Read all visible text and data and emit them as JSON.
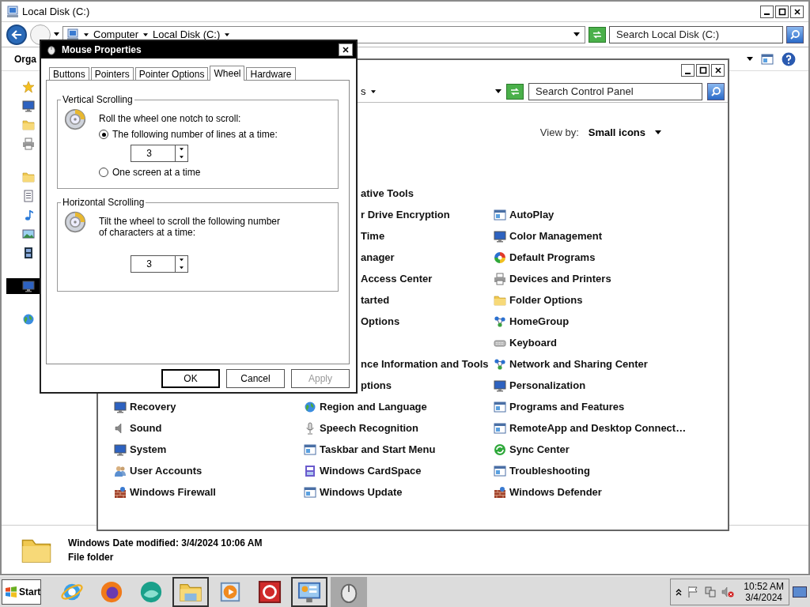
{
  "explorer": {
    "title": "Local Disk (C:)",
    "breadcrumb": [
      "Computer",
      "Local Disk (C:)"
    ],
    "search": {
      "placeholder": "Search Local Disk (C:)"
    },
    "organize": "Orga",
    "nav": [
      {
        "kind": "star",
        "selected": false
      },
      {
        "kind": "monitor",
        "selected": false
      },
      {
        "kind": "folder",
        "selected": false
      },
      {
        "kind": "printer",
        "selected": false
      },
      {
        "kind": "folder",
        "selected": false
      },
      {
        "kind": "document",
        "selected": false
      },
      {
        "kind": "music",
        "selected": false
      },
      {
        "kind": "picture",
        "selected": false
      },
      {
        "kind": "film",
        "selected": false
      },
      {
        "kind": "monitor",
        "selected": true
      },
      {
        "kind": "globe",
        "selected": false
      }
    ],
    "details": {
      "name": "Windows",
      "modified": "Date modified: 3/4/2024 10:06 AM",
      "type": "File folder"
    }
  },
  "control_panel": {
    "breadcrumb_tail": "s",
    "search": {
      "placeholder": "Search Control Panel"
    },
    "view_by": {
      "label": "View by:",
      "value": "Small icons"
    },
    "columns": [
      {
        "groups": [
          [
            {
              "label": "Recovery",
              "kind": "monitor"
            },
            {
              "label": "Sound",
              "kind": "speaker"
            },
            {
              "label": "System",
              "kind": "monitor"
            },
            {
              "label": "User Accounts",
              "kind": "people"
            },
            {
              "label": "Windows Firewall",
              "kind": "wall"
            }
          ]
        ]
      },
      {
        "groups": [
          [
            {
              "label": "ative Tools",
              "kind": "partial"
            },
            {
              "label": "r Drive Encryption",
              "kind": "partial"
            },
            {
              "label": "Time",
              "kind": "partial"
            },
            {
              "label": "anager",
              "kind": "partial"
            },
            {
              "label": "Access Center",
              "kind": "partial"
            },
            {
              "label": "tarted",
              "kind": "partial"
            },
            {
              "label": "Options",
              "kind": "partial"
            }
          ],
          [
            {
              "label": "nce Information and Tools",
              "kind": "partial"
            },
            {
              "label": "ptions",
              "kind": "partial"
            },
            {
              "label": "Region and Language",
              "kind": "globe"
            },
            {
              "label": "Speech Recognition",
              "kind": "mic"
            },
            {
              "label": "Taskbar and Start Menu",
              "kind": "window"
            },
            {
              "label": "Windows CardSpace",
              "kind": "card"
            },
            {
              "label": "Windows Update",
              "kind": "window"
            }
          ]
        ]
      },
      {
        "groups": [
          [
            {
              "label": "AutoPlay",
              "kind": "window"
            },
            {
              "label": "Color Management",
              "kind": "monitor"
            },
            {
              "label": "Default Programs",
              "kind": "colorwheel"
            },
            {
              "label": "Devices and Printers",
              "kind": "printer"
            },
            {
              "label": "Folder Options",
              "kind": "folder"
            },
            {
              "label": "HomeGroup",
              "kind": "network"
            },
            {
              "label": "Keyboard",
              "kind": "keyboard"
            },
            {
              "label": "Network and Sharing Center",
              "kind": "network"
            },
            {
              "label": "Personalization",
              "kind": "monitor"
            },
            {
              "label": "Programs and Features",
              "kind": "window"
            },
            {
              "label": "RemoteApp and Desktop Connect…",
              "kind": "window"
            },
            {
              "label": "Sync Center",
              "kind": "sync"
            },
            {
              "label": "Troubleshooting",
              "kind": "window"
            },
            {
              "label": "Windows Defender",
              "kind": "wall"
            }
          ]
        ]
      }
    ]
  },
  "dialog": {
    "title": "Mouse Properties",
    "tabs": [
      {
        "label": "Buttons",
        "selected": false
      },
      {
        "label": "Pointers",
        "selected": false
      },
      {
        "label": "Pointer Options",
        "selected": false
      },
      {
        "label": "Wheel",
        "selected": true
      },
      {
        "label": "Hardware",
        "selected": false
      }
    ],
    "vertical": {
      "legend": "Vertical Scrolling",
      "prompt": "Roll the wheel one notch to scroll:",
      "options": [
        {
          "label": "The following number of lines at a time:",
          "selected": true,
          "value": "3"
        },
        {
          "label": "One screen at a time",
          "selected": false
        }
      ]
    },
    "horizontal": {
      "legend": "Horizontal Scrolling",
      "prompt": "Tilt the wheel to scroll the following number of characters at a time:",
      "value": "3"
    },
    "buttons": [
      {
        "label": "OK",
        "default": true,
        "disabled": false
      },
      {
        "label": "Cancel",
        "default": false,
        "disabled": false
      },
      {
        "label": "Apply",
        "default": false,
        "disabled": true
      }
    ]
  },
  "taskbar": {
    "start": "Start",
    "apps": [
      {
        "kind": "ie",
        "open": false,
        "selected": false
      },
      {
        "kind": "fox",
        "open": false,
        "selected": false
      },
      {
        "kind": "bubble",
        "open": false,
        "selected": false
      },
      {
        "kind": "explorer",
        "open": true,
        "selected": false
      },
      {
        "kind": "media",
        "open": false,
        "selected": false
      },
      {
        "kind": "redapp",
        "open": false,
        "selected": false
      },
      {
        "kind": "cpanel",
        "open": true,
        "selected": false
      },
      {
        "kind": "mouse",
        "open": false,
        "selected": true
      }
    ],
    "time": "10:52 AM",
    "date": "3/4/2024"
  }
}
